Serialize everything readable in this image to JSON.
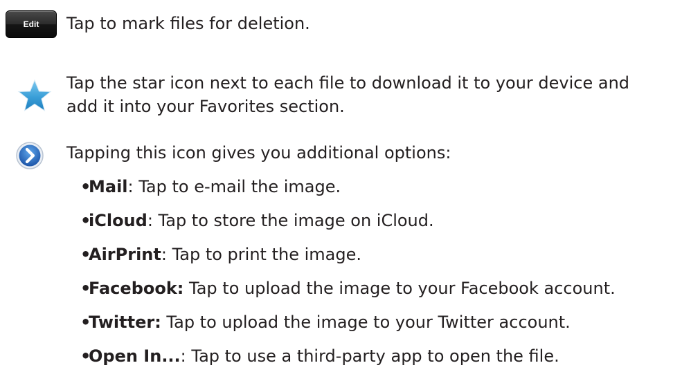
{
  "edit_button": {
    "label": "Edit",
    "description": "Tap to mark files for deletion."
  },
  "star": {
    "icon": "star-icon",
    "color": "#3a9fd8",
    "description_line1": "Tap the star icon next to each file to download it to your device and",
    "description_line2": "add it into your Favorites section."
  },
  "disclosure": {
    "icon": "chevron-right-circle-icon",
    "color": "#2d6fc4",
    "description": "Tapping this icon gives you additional options:"
  },
  "options": [
    {
      "term": "Mail",
      "desc": ": Tap to e-mail the image."
    },
    {
      "term": "iCloud",
      "desc": ": Tap to store the image on iCloud."
    },
    {
      "term": "AirPrint",
      "desc": ": Tap to print the image."
    },
    {
      "term": "Facebook:",
      "desc": " Tap to upload the image to your Facebook account."
    },
    {
      "term": "Twitter:",
      "desc": " Tap to upload the image to your Twitter account."
    },
    {
      "term": "Open In...",
      "desc": ": Tap to use a third-party app to open the file."
    }
  ]
}
